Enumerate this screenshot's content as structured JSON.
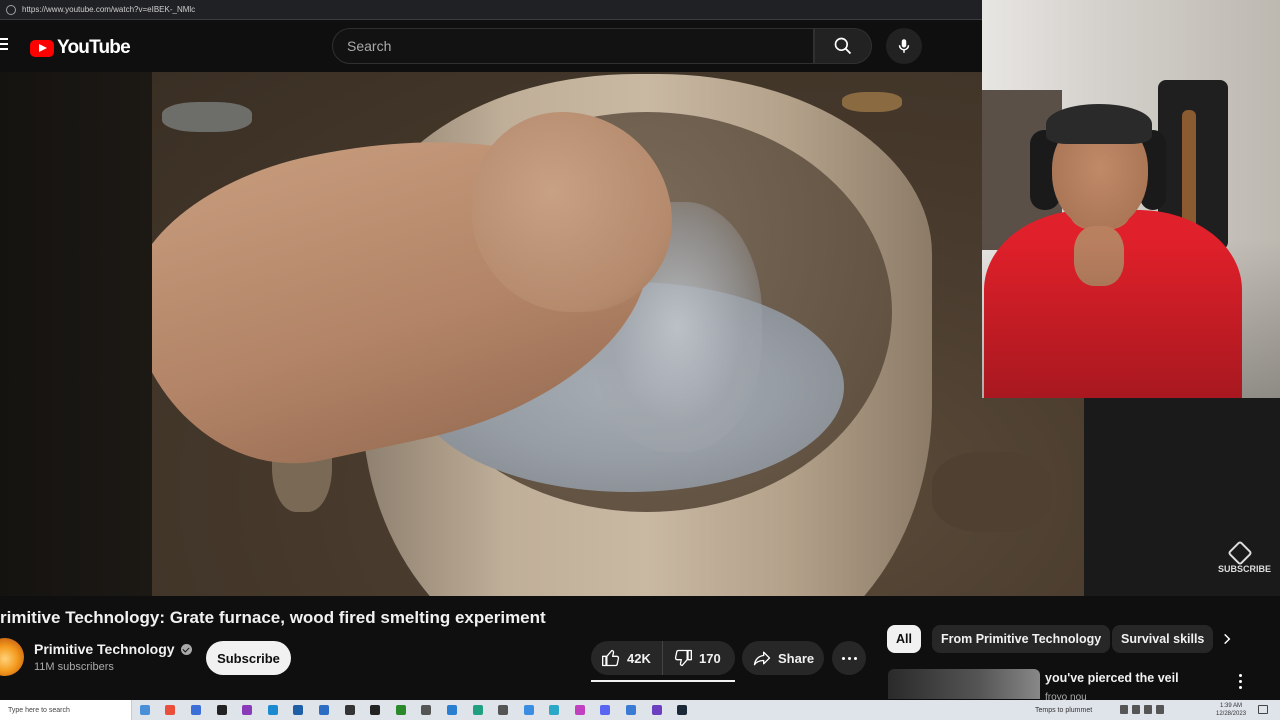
{
  "browser": {
    "url": "https://www.youtube.com/watch?v=eIBEK-_NMlc"
  },
  "header": {
    "logo_text": "YouTube",
    "search_placeholder": "Search"
  },
  "video": {
    "title": "rimitive Technology: Grate furnace, wood fired smelting experiment",
    "overlay_watermark": "SUBSCRIBE"
  },
  "channel": {
    "name": "Primitive Technology",
    "subscribers": "11M subscribers",
    "subscribe_label": "Subscribe"
  },
  "actions": {
    "likes": "42K",
    "dislikes": "170",
    "share_label": "Share"
  },
  "chips": [
    {
      "label": "All",
      "active": true
    },
    {
      "label": "From Primitive Technology",
      "active": false
    },
    {
      "label": "Survival skills",
      "active": false
    }
  ],
  "up_next": {
    "title": "you've pierced the veil",
    "subtitle": "froyo nou"
  },
  "taskbar": {
    "search_placeholder": "Type here to search",
    "weather": "Temps to plummet",
    "time": "1:39 AM",
    "date": "12/28/2023",
    "app_icons": [
      "#4a90d9",
      "#e94f3a",
      "#3c6fd8",
      "#222",
      "#8a3ab8",
      "#1b8ad1",
      "#1f5fa8",
      "#2d6ec4",
      "#333",
      "#222",
      "#2a8a2a",
      "#555",
      "#2b7fd0",
      "#20a080",
      "#555",
      "#3a8de0",
      "#2aa8c8",
      "#c040c0",
      "#5865f2",
      "#3b7bd4",
      "#6b3fc0",
      "#1b2838"
    ],
    "icons": [
      "search-icon",
      "start-icon",
      "task-view-icon"
    ]
  },
  "colors": {
    "brand_red": "#ff0000",
    "background": "#0f0f0f",
    "chip_bg": "#272727",
    "webcam_shirt": "#e0202a"
  }
}
